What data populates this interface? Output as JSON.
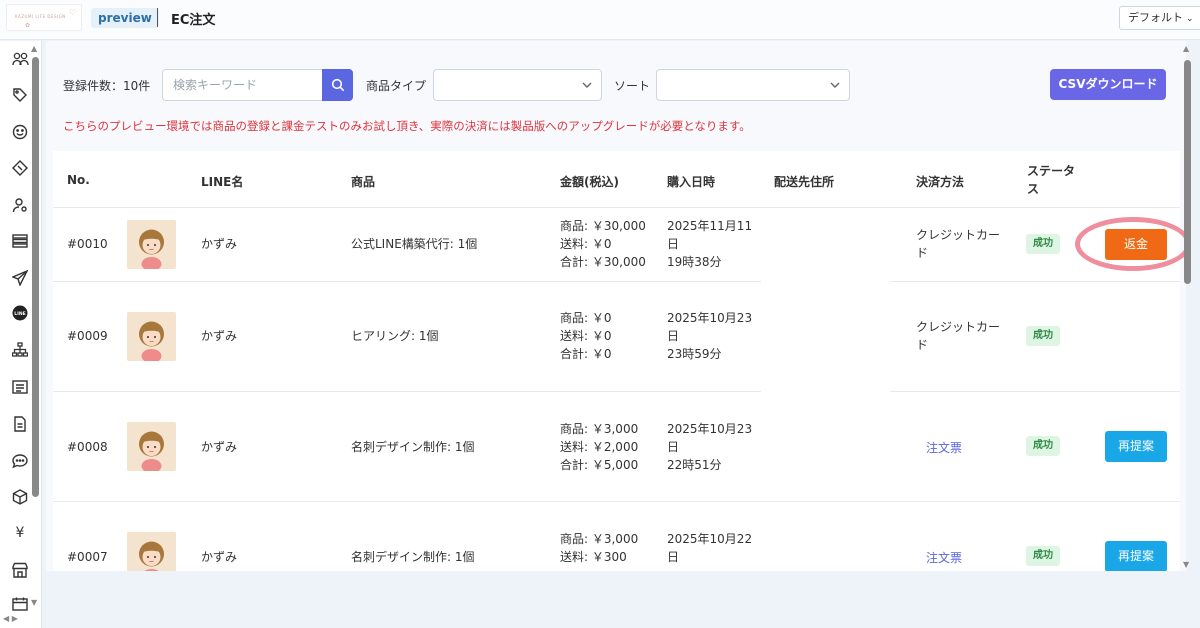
{
  "header": {
    "logo_text": "KAZUMI LIFE DESIGN",
    "preview_label": "preview",
    "title": "EC注文",
    "view_select": "デフォルト"
  },
  "filters": {
    "count_label": "登録件数：10件",
    "search_placeholder": "検索キーワード",
    "product_type_label": "商品タイプ",
    "sort_label": "ソート",
    "csv_button": "CSVダウンロード"
  },
  "notice": "こちらのプレビュー環境では商品の登録と課金テストのみお試し頂き、実際の決済には製品版へのアップグレードが必要となります。",
  "table": {
    "headers": {
      "no": "No.",
      "line_name": "LINE名",
      "product": "商品",
      "amount": "金額(税込)",
      "purchase_date": "購入日時",
      "shipping_address": "配送先住所",
      "payment_method": "決済方法",
      "status": "ステータス"
    },
    "rows": [
      {
        "no": "#0010",
        "line_name": "かずみ",
        "product": "公式LINE構築代行: 1個",
        "amount_product": "商品: ￥30,000",
        "amount_shipping": "送料: ￥0",
        "amount_total": "合計: ￥30,000",
        "date_line1": "2025年11月11",
        "date_line2": "日",
        "date_line3": "19時38分",
        "payment": "クレジットカード",
        "payment_line1": "クレジットカー",
        "payment_line2": "ド",
        "status": "成功",
        "action": "返金"
      },
      {
        "no": "#0009",
        "line_name": "かずみ",
        "product": "ヒアリング: 1個",
        "amount_product": "商品: ￥0",
        "amount_shipping": "送料: ￥0",
        "amount_total": "合計: ￥0",
        "date_line1": "2025年10月23",
        "date_line2": "日",
        "date_line3": "23時59分",
        "payment_line1": "クレジットカー",
        "payment_line2": "ド",
        "status": "成功"
      },
      {
        "no": "#0008",
        "line_name": "かずみ",
        "product": "名刺デザイン制作: 1個",
        "amount_product": "商品: ￥3,000",
        "amount_shipping": "送料: ￥2,000",
        "amount_total": "合計: ￥5,000",
        "date_line1": "2025年10月23",
        "date_line2": "日",
        "date_line3": "22時51分",
        "payment": "注文票",
        "status": "成功",
        "action": "再提案"
      },
      {
        "no": "#0007",
        "line_name": "かずみ",
        "product": "名刺デザイン制作: 1個",
        "amount_product": "商品: ￥3,000",
        "amount_shipping": "送料: ￥300",
        "date_line1": "2025年10月22",
        "date_line2": "日",
        "payment": "注文票",
        "status": "成功",
        "action": "再提案"
      }
    ]
  },
  "colors": {
    "primary": "#5a67e0",
    "csv_button": "#6a67e6",
    "refund": "#f06a16",
    "repropose": "#1aa7e8",
    "notice": "#e0333d",
    "success_bg": "#dff5e4",
    "success_text": "#2e8a45"
  },
  "icons": [
    "users-icon",
    "tag-icon",
    "smile-icon",
    "ticket-icon",
    "user-settings-icon",
    "list-icon",
    "send-icon",
    "line-icon",
    "org-chart-icon",
    "article-icon",
    "document-icon",
    "chat-icon",
    "box-icon",
    "yen-icon",
    "store-icon",
    "calendar-icon"
  ]
}
